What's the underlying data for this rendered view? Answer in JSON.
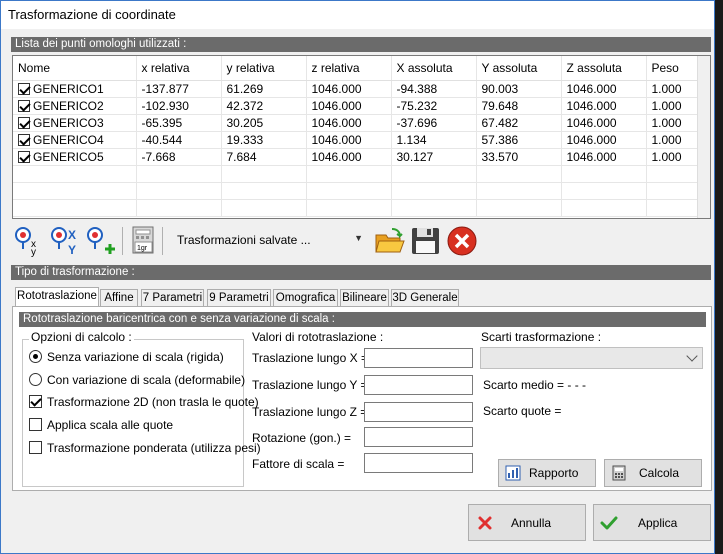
{
  "window": {
    "title": "Trasformazione di coordinate"
  },
  "points_section": {
    "title": "Lista dei punti omologhi utilizzati :",
    "columns": [
      "Nome",
      "x relativa",
      "y relativa",
      "z relativa",
      "X assoluta",
      "Y assoluta",
      "Z assoluta",
      "Peso"
    ],
    "rows": [
      {
        "checked": true,
        "cells": [
          "GENERICO1",
          "-137.877",
          "61.269",
          "1046.000",
          "-94.388",
          "90.003",
          "1046.000",
          "1.000"
        ]
      },
      {
        "checked": true,
        "cells": [
          "GENERICO2",
          "-102.930",
          "42.372",
          "1046.000",
          "-75.232",
          "79.648",
          "1046.000",
          "1.000"
        ]
      },
      {
        "checked": true,
        "cells": [
          "GENERICO3",
          "-65.395",
          "30.205",
          "1046.000",
          "-37.696",
          "67.482",
          "1046.000",
          "1.000"
        ]
      },
      {
        "checked": true,
        "cells": [
          "GENERICO4",
          "-40.544",
          "19.333",
          "1046.000",
          "1.134",
          "57.386",
          "1046.000",
          "1.000"
        ]
      },
      {
        "checked": true,
        "cells": [
          "GENERICO5",
          "-7.668",
          "7.684",
          "1046.000",
          "30.127",
          "33.570",
          "1046.000",
          "1.000"
        ]
      }
    ]
  },
  "toolbar": {
    "saved_select": "Trasformazioni salvate ...",
    "icon_1gr_label": "1gr"
  },
  "transform_section": {
    "title": "Tipo di trasformazione :"
  },
  "tabs": [
    {
      "label": "Rototraslazione",
      "active": true
    },
    {
      "label": "Affine"
    },
    {
      "label": "7 Parametri"
    },
    {
      "label": "9 Parametri"
    },
    {
      "label": "Omografica"
    },
    {
      "label": "Bilineare"
    },
    {
      "label": "3D Generale"
    }
  ],
  "panel": {
    "title": "Rototraslazione baricentrica con e senza variazione di scala :",
    "options_group": {
      "title": "Opzioni di calcolo :",
      "radio_rigid": "Senza variazione di scala (rigida)",
      "radio_deform": "Con variazione di scala (deformabile)",
      "check_2d": "Trasformazione 2D (non trasla le quote)",
      "check_scale_quote": "Applica scala alle quote",
      "check_weighted": "Trasformazione ponderata (utilizza pesi)"
    },
    "values": {
      "title": "Valori di rototraslazione :",
      "tx": "Traslazione lungo X =",
      "ty": "Traslazione lungo Y =",
      "tz": "Traslazione lungo Z =",
      "rot": "Rotazione (gon.) =",
      "scale": "Fattore di scala ="
    },
    "residuals": {
      "title": "Scarti trasformazione :",
      "mean": "Scarto medio = - - -",
      "quote": "Scarto quote ="
    },
    "buttons": {
      "report": "Rapporto",
      "compute": "Calcola"
    }
  },
  "footer": {
    "cancel": "Annulla",
    "apply": "Applica"
  }
}
